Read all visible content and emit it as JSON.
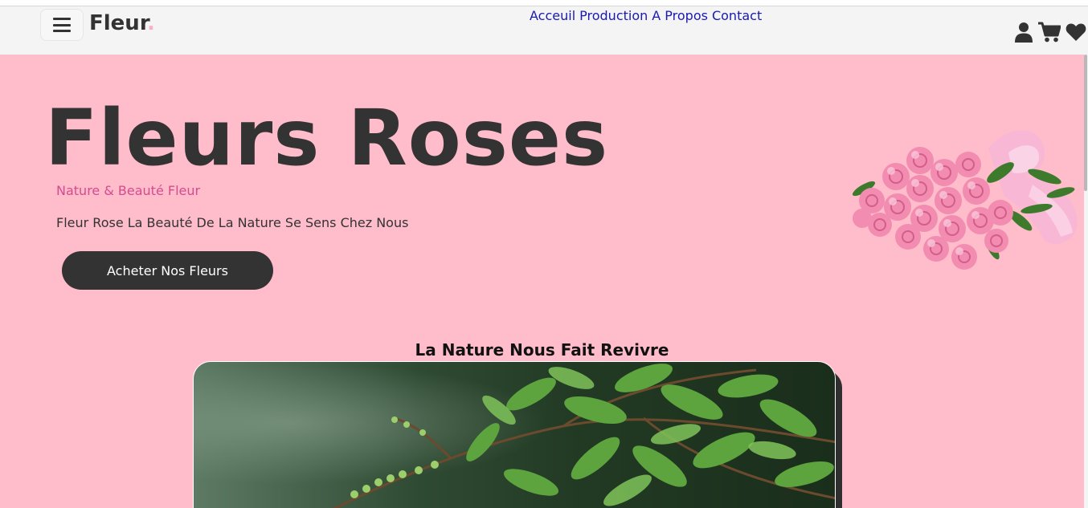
{
  "header": {
    "logo_text": "Fleur",
    "logo_dot": ".",
    "nav": [
      "Acceuil",
      "Production",
      "A Propos",
      "Contact"
    ],
    "icons": [
      "user-icon",
      "cart-icon",
      "heart-icon"
    ]
  },
  "hero": {
    "title": "Fleurs Roses",
    "subtitle": "Nature & Beauté Fleur",
    "text": "Fleur Rose La Beauté De La Nature Se Sens Chez Nous",
    "button_label": "Acheter Nos Fleurs"
  },
  "section": {
    "title": "La Nature Nous Fait Revivre"
  },
  "colors": {
    "hero_bg": "#ffbccb",
    "header_bg": "#f4f4f4",
    "dark": "#333333",
    "accent_pink": "#d54b8f",
    "nav_link": "#1a1ab0"
  }
}
